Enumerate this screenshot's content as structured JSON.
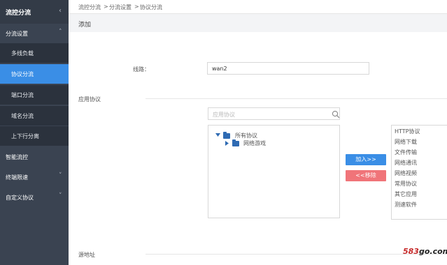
{
  "sidebar": {
    "header": "流控分流",
    "groups": [
      {
        "label": "分流设置"
      },
      {
        "label": "智能流控"
      },
      {
        "label": "终端限速"
      },
      {
        "label": "自定义协议"
      }
    ],
    "subitems": [
      {
        "label": "多线负载"
      },
      {
        "label": "协议分流"
      },
      {
        "label": "端口分流"
      },
      {
        "label": "域名分流"
      },
      {
        "label": "上下行分离"
      }
    ]
  },
  "breadcrumb": {
    "items": [
      "流控分流",
      "分流设置",
      "协议分流"
    ],
    "sep": ">"
  },
  "page": {
    "title": "添加"
  },
  "form": {
    "line_label": "线路：",
    "line_value": "wan2",
    "app_protocol_label": "应用协议",
    "search_placeholder": "应用协议",
    "source_address_label": "源地址"
  },
  "tree": {
    "root": "所有协议",
    "child": "网络游戏"
  },
  "buttons": {
    "add": "加入>>",
    "remove": "<<移除"
  },
  "protocol_list": [
    "HTTP协议",
    "网络下载",
    "文件传输",
    "网络通讯",
    "网络视频",
    "常用协议",
    "其它应用",
    "测速软件"
  ],
  "watermark": {
    "num": "583",
    "rest": "go.com"
  },
  "colors": {
    "sidebar_bg": "#3a4351",
    "active": "#3a8ee6",
    "remove_button": "#f07479",
    "folder": "#2f6bb3"
  }
}
